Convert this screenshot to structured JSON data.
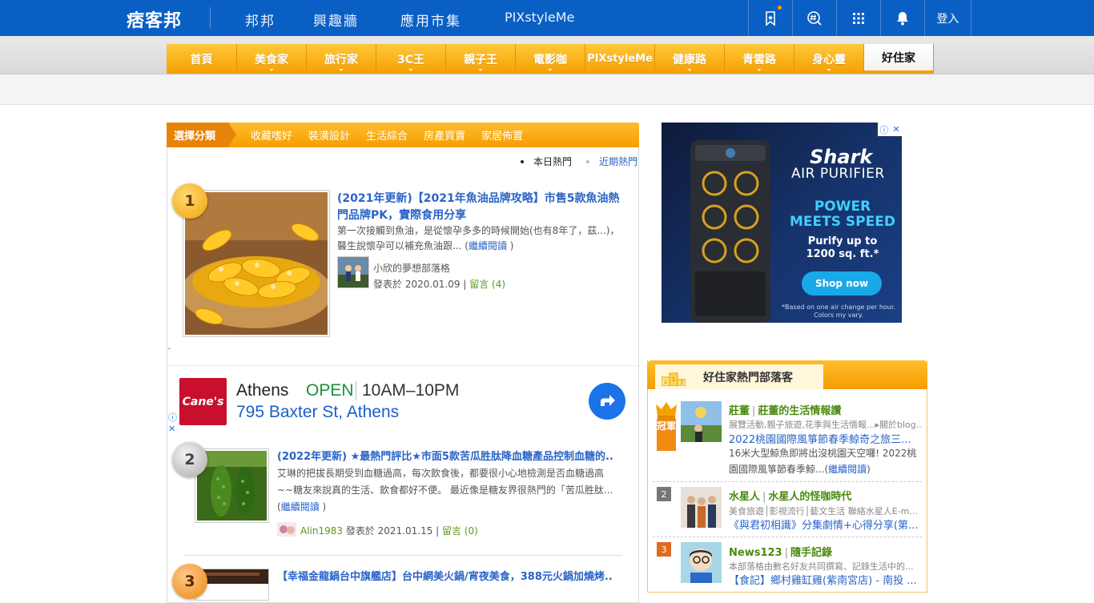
{
  "header": {
    "logo": "痞客邦",
    "nav": [
      "邦邦",
      "興趣牆",
      "應用市集",
      "PIXstyleMe"
    ],
    "login": "登入"
  },
  "categories": [
    {
      "label": "首頁",
      "caret": false
    },
    {
      "label": "美食家",
      "caret": true
    },
    {
      "label": "旅行家",
      "caret": true
    },
    {
      "label": "3C王",
      "caret": true
    },
    {
      "label": "親子王",
      "caret": true
    },
    {
      "label": "電影咖",
      "caret": true
    },
    {
      "label": "PIXstyleMe",
      "caret": false
    },
    {
      "label": "健康路",
      "caret": true
    },
    {
      "label": "青雲路",
      "caret": true
    },
    {
      "label": "身心靈",
      "caret": true
    },
    {
      "label": "好住家",
      "caret": false
    }
  ],
  "tabs": {
    "selected": "選擇分類",
    "items": [
      "收藏嗜好",
      "裝潢設計",
      "生活綜合",
      "房產買賣",
      "家居佈置"
    ]
  },
  "hot": {
    "today": "本日熱門",
    "recent": "近期熱門"
  },
  "articles": [
    {
      "rank": "1",
      "title": "(2021年更新)【2021年魚油品牌攻略】市售5款魚油熱門品牌PK，實際食用分享",
      "excerpt": "第一次接觸到魚油，是從懷孕多多的時候開始(也有8年了，茲...)，醫生說懷孕可以補充魚油跟... (",
      "more": "繼續閱讀",
      "close": " )",
      "author": "小欣的夢想部落格",
      "posted": "發表於 2020.01.09 | ",
      "comments": "留言 (4)"
    },
    {
      "rank": "2",
      "title": "(2022年更新) ★最熱門評比★市面5款苦瓜胜肽降血糖產品控制血糖的...",
      "excerpt": "艾琳的把拔長期受到血糖過高，每次飲食後，都要很小心地檢測是否血糖過高~~糖友來說真的生活、飲食都好不便。 最近像是糖友界很熱門的「苦瓜胜肽... (",
      "more": "繼續閱讀",
      "close": " )",
      "author": "Alin1983",
      "posted": " 發表於 2021.01.15 | ",
      "comments": "留言 (0)"
    },
    {
      "rank": "3",
      "title": "【幸福金龍鍋台中旗艦店】台中網美火鍋/宵夜美食，388元火鍋加燒烤..."
    }
  ],
  "stray": "`",
  "ad_place": {
    "brand": "Cane's",
    "name": "Athens",
    "status": "OPEN",
    "hours": "10AM–10PM",
    "address": "795 Baxter St, Athens"
  },
  "shark_ad": {
    "brand": "Shark",
    "product": "AIR PURIFIER",
    "headline": "POWER MEETS SPEED",
    "claim": "Purify up to 1200 sq. ft.*",
    "cta": "Shop now",
    "note": "*Based on one air change per hour. Colors my vary."
  },
  "blogs": {
    "title": "好住家熱門部落客",
    "crown_label": "冠軍",
    "items": [
      {
        "rank": "1",
        "name": "莊董",
        "blog": "莊董的生活情報讚",
        "desc": "展覽活動,親子旅遊,花季與生活情報...▸關於blog...",
        "post": "2022桃園國際風箏節春季鯨奇之旅三...",
        "text": "16米大型鯨魚即將出沒桃園天空囉! 2022桃園國際風箏節春季鯨...(",
        "more": "繼續閱讀",
        "close": ")"
      },
      {
        "rank": "2",
        "name": "水星人",
        "blog": "水星人的怪咖時代",
        "desc": "美食旅遊│影視流行│藝文生活 聯絡水星人E-m...",
        "post": "《與君初相識》分集劇情+心得分享(第..."
      },
      {
        "rank": "3",
        "name": "News123",
        "blog": "隨手記錄",
        "desc": "本部落格由數名好友共同撰寫、記錄生活中的...",
        "post": "【食記】鄉村雞缸雞(紫南宮店) - 南投 ..."
      }
    ]
  },
  "colors": {
    "brand_blue": "#0a5fc4",
    "accent_orange": "#f5a000",
    "link_blue": "#2a64c8",
    "author_green": "#5a9a1a"
  }
}
